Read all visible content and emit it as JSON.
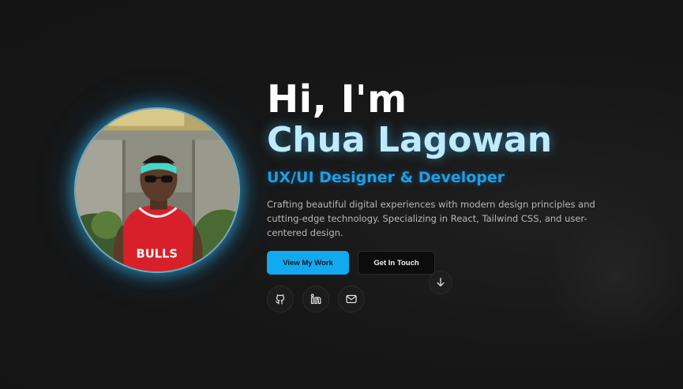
{
  "hero": {
    "greeting": "Hi, I'm",
    "name": "Chua Lagowan",
    "role": "UX/UI Designer & Developer",
    "bio": "Crafting beautiful digital experiences with modern design principles and cutting-edge technology. Specializing in React, Tailwind CSS, and user-centered design.",
    "avatar_icon": "profile-photo",
    "accent_color": "#12a9ee",
    "name_color": "#bfeaff"
  },
  "buttons": {
    "primary_label": "View My Work",
    "secondary_label": "Get In Touch"
  },
  "socials": [
    {
      "icon": "github-icon"
    },
    {
      "icon": "linkedin-icon"
    },
    {
      "icon": "mail-icon"
    }
  ],
  "scroll": {
    "icon": "arrow-down-icon"
  }
}
